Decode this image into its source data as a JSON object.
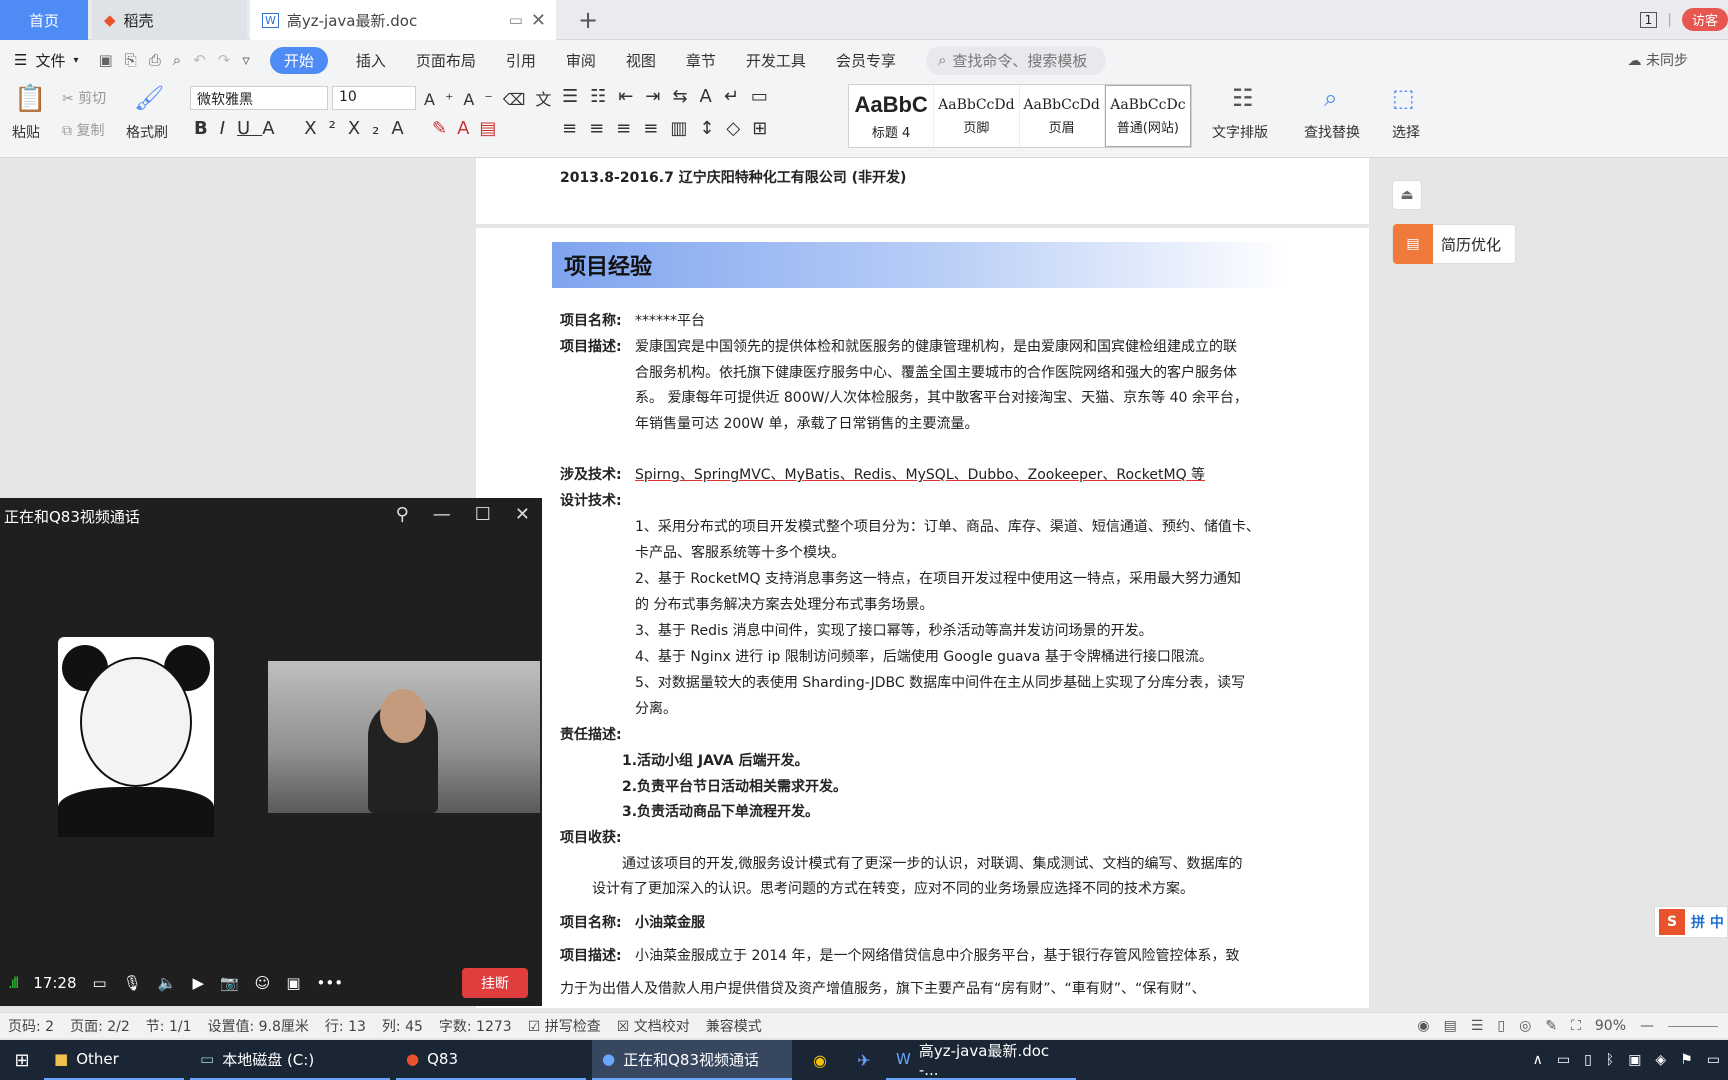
{
  "tabs": {
    "home": "首页",
    "daoke": "稻壳",
    "doc": "高yz-java最新.doc"
  },
  "tabbar": {
    "page_num": "1",
    "visitor": "访客"
  },
  "menu": {
    "file": "文件",
    "items": [
      "开始",
      "插入",
      "页面布局",
      "引用",
      "审阅",
      "视图",
      "章节",
      "开发工具",
      "会员专享"
    ],
    "search_placeholder": "查找命令、搜索模板",
    "sync": "未同步"
  },
  "ribbon": {
    "paste": "粘贴",
    "cut": "剪切",
    "copy": "复制",
    "format_painter": "格式刷",
    "font": "微软雅黑",
    "size": "10",
    "styles": [
      {
        "sample": "AaBbC",
        "caption": "标题 4"
      },
      {
        "sample": "AaBbCcDd",
        "caption": "页脚"
      },
      {
        "sample": "AaBbCcDd",
        "caption": "页眉"
      },
      {
        "sample": "AaBbCcDc",
        "caption": "普通(网站)"
      }
    ],
    "text_layout": "文字排版",
    "find_replace": "查找替换",
    "select": "选择"
  },
  "doc": {
    "work_line": "2013.8-2016.7    辽宁庆阳特种化工有限公司     (非开发)",
    "section_title": "项目经验",
    "p1_name_label": "项目名称:",
    "p1_name": "******平台",
    "p1_desc_label": "项目描述:",
    "p1_desc": [
      "爱康国宾是中国领先的提供体检和就医服务的健康管理机构，是由爱康网和国宾健检组建成立的联",
      "合服务机构。依托旗下健康医疗服务中心、覆盖全国主要城市的合作医院网络和强大的客户服务体",
      "系。  爱康每年可提供近 800W/人次体检服务，其中散客平台对接淘宝、天猫、京东等 40 余平台，",
      "年销售量可达 200W 单，承载了日常销售的主要流量。"
    ],
    "tech_label": "涉及技术:",
    "tech": "Spirng、SpringMVC、MyBatis、Redis、MySQL、Dubbo、Zookeeper、RocketMQ 等",
    "design_label": "设计技术:",
    "design": [
      "1、采用分布式的项目开发模式整个项目分为：订单、商品、库存、渠道、短信通道、预约、储值卡、",
      "卡产品、客服系统等十多个模块。",
      "2、基于 RocketMQ 支持消息事务这一特点，在项目开发过程中使用这一特点，采用最大努力通知",
      "的 分布式事务解决方案去处理分布式事务场景。",
      "3、基于 Redis 消息中间件，实现了接口幂等，秒杀活动等高并发访问场景的开发。",
      "4、基于 Nginx 进行 ip 限制访问频率，后端使用 Google guava 基于令牌桶进行接口限流。",
      "5、对数据量较大的表使用 Sharding-JDBC 数据库中间件在主从同步基础上实现了分库分表，读写",
      "分离。"
    ],
    "resp_label": "责任描述:",
    "resp": [
      "1.活动小组 JAVA 后端开发。",
      "2.负责平台节日活动相关需求开发。",
      "3.负责活动商品下单流程开发。"
    ],
    "gain_label": "项目收获:",
    "gain": [
      "通过该项目的开发,微服务设计模式有了更深一步的认识，对联调、集成测试、文档的编写、数据库的",
      "设计有了更加深入的认识。思考问题的方式在转变，应对不同的业务场景应选择不同的技术方案。"
    ],
    "p2_name_label": "项目名称:",
    "p2_name": "小油菜金服",
    "p2_desc_label": "项目描述:",
    "p2_desc": [
      "小油菜金服成立于 2014 年，是一个网络借贷信息中介服务平台，基于银行存管风险管控体系，致",
      "力于为出借人及借款人用户提供借贷及资产增值服务，旗下主要产品有“房有财”、“車有财”、“保有财”、"
    ]
  },
  "side": {
    "resume_opt": "简历优化",
    "pinyin": "拼 中"
  },
  "video": {
    "title": "正在和Q83视频通话",
    "time": "17:28",
    "hangup": "挂断"
  },
  "status": {
    "page_code": "页码: 2",
    "pages": "页面: 2/2",
    "section": "节: 1/1",
    "setting": "设置值: 9.8厘米",
    "row": "行: 13",
    "col": "列: 45",
    "words": "字数: 1273",
    "spell": "拼写检查",
    "proof": "文档校对",
    "compat": "兼容模式",
    "zoom": "90%"
  },
  "taskbar": {
    "other": "Other",
    "disk": "本地磁盘 (C:)",
    "q83": "Q83",
    "video": "正在和Q83视频通话",
    "doc": "高yz-java最新.doc -..."
  }
}
